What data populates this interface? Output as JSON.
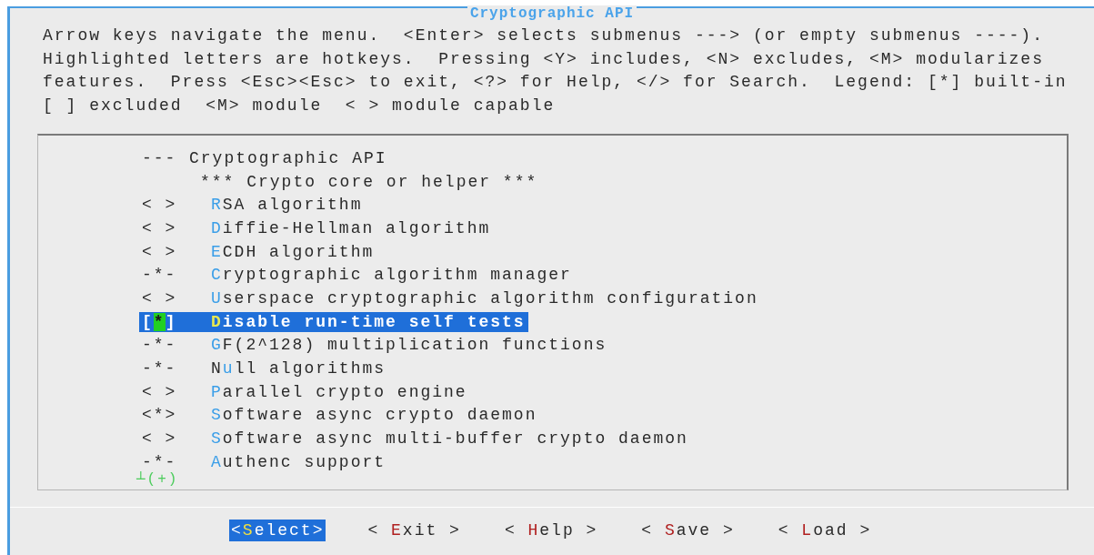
{
  "window": {
    "title": "Cryptographic API"
  },
  "help_text": [
    "Arrow keys navigate the menu.  <Enter> selects submenus ---> (or empty submenus ----).",
    "Highlighted letters are hotkeys.  Pressing <Y> includes, <N> excludes, <M> modularizes",
    "features.  Press <Esc><Esc> to exit, <?> for Help, </> for Search.  Legend: [*] built-in",
    "[ ] excluded  <M> module  < > module capable"
  ],
  "items": [
    {
      "kind": "header",
      "mark": "---",
      "after": "Cryptographic API",
      "selected": false
    },
    {
      "kind": "comment",
      "after": "*** Crypto core or helper ***",
      "selected": false
    },
    {
      "kind": "option",
      "mark": "< >",
      "hotkey": "R",
      "after": "SA algorithm",
      "selected": false
    },
    {
      "kind": "option",
      "mark": "< >",
      "hotkey": "D",
      "after": "iffie-Hellman algorithm",
      "selected": false
    },
    {
      "kind": "option",
      "mark": "< >",
      "hotkey": "E",
      "after": "CDH algorithm",
      "selected": false
    },
    {
      "kind": "option",
      "mark": "-*-",
      "hotkey": "C",
      "after": "ryptographic algorithm manager",
      "selected": false
    },
    {
      "kind": "option",
      "mark": "< >",
      "hotkey": "U",
      "after": "serspace cryptographic algorithm configuration",
      "selected": false
    },
    {
      "kind": "option",
      "mark": "[*]",
      "hotkey": "D",
      "after": "isable run-time self tests",
      "selected": true
    },
    {
      "kind": "option",
      "mark": "-*-",
      "hotkey": "G",
      "after": "F(2^128) multiplication functions",
      "selected": false
    },
    {
      "kind": "option",
      "mark": "-*-",
      "before": "N",
      "hotkey": "u",
      "after": "ll algorithms",
      "selected": false
    },
    {
      "kind": "option",
      "mark": "< >",
      "hotkey": "P",
      "after": "arallel crypto engine",
      "selected": false
    },
    {
      "kind": "option",
      "mark": "<*>",
      "hotkey": "S",
      "after": "oftware async crypto daemon",
      "selected": false
    },
    {
      "kind": "option",
      "mark": "< >",
      "hotkey": "S",
      "after": "oftware async multi-buffer crypto daemon",
      "selected": false
    },
    {
      "kind": "option",
      "mark": "-*-",
      "hotkey": "A",
      "after": "uthenc support",
      "selected": false
    }
  ],
  "more_indicator": "┴(+)",
  "buttons": [
    {
      "before": "<",
      "hotkey": "S",
      "after": "elect>",
      "selected": true
    },
    {
      "before": "< ",
      "hotkey": "E",
      "after": "xit >",
      "selected": false
    },
    {
      "before": "< ",
      "hotkey": "H",
      "after": "elp >",
      "selected": false
    },
    {
      "before": "< ",
      "hotkey": "S",
      "after": "ave >",
      "selected": false
    },
    {
      "before": "< ",
      "hotkey": "L",
      "after": "oad >",
      "selected": false
    }
  ]
}
